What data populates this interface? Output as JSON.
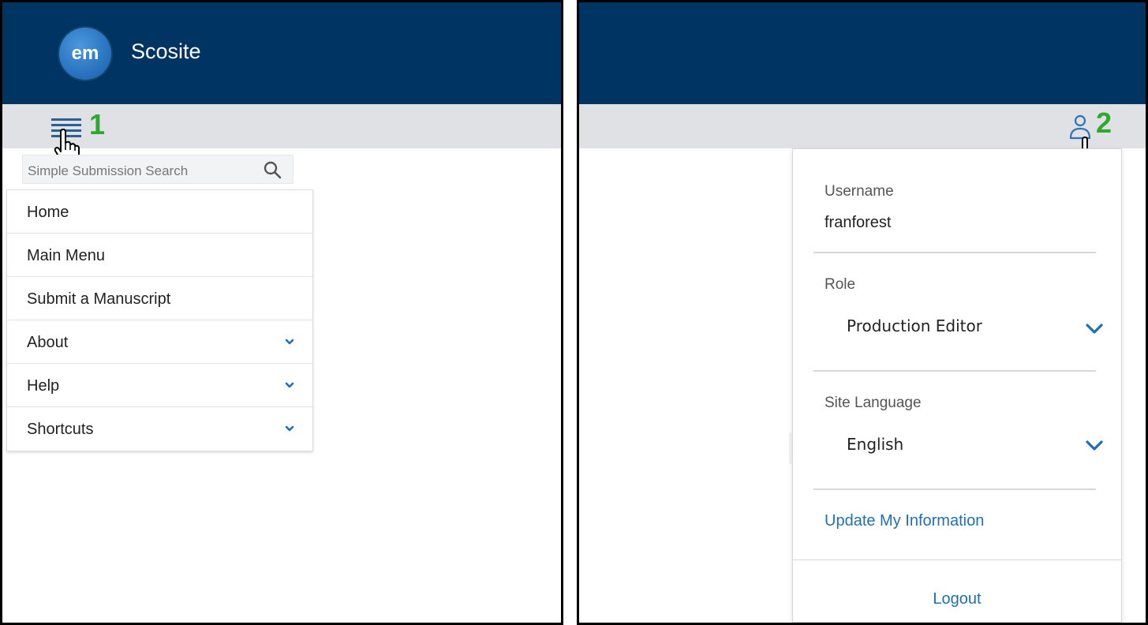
{
  "left_panel": {
    "site_name": "Scosite",
    "logo_text": "em",
    "step_label": "1",
    "search": {
      "placeholder": "Simple Submission Search"
    },
    "menu_items": [
      {
        "label": "Home",
        "expandable": false
      },
      {
        "label": "Main Menu",
        "expandable": false
      },
      {
        "label": "Submit a Manuscript",
        "expandable": false
      },
      {
        "label": "About",
        "expandable": true
      },
      {
        "label": "Help",
        "expandable": true
      },
      {
        "label": "Shortcuts",
        "expandable": true
      }
    ]
  },
  "right_panel": {
    "step_label": "2",
    "username_label": "Username",
    "username_value": "franforest",
    "role_label": "Role",
    "role_value": "Production Editor",
    "language_label": "Site Language",
    "language_value": "English",
    "update_link": "Update My Information",
    "logout_link": "Logout"
  },
  "colors": {
    "header_bg": "#003563",
    "toolbar_bg": "#dfe1e4",
    "accent": "#1f6fb4",
    "step_green": "#2fa82f"
  }
}
